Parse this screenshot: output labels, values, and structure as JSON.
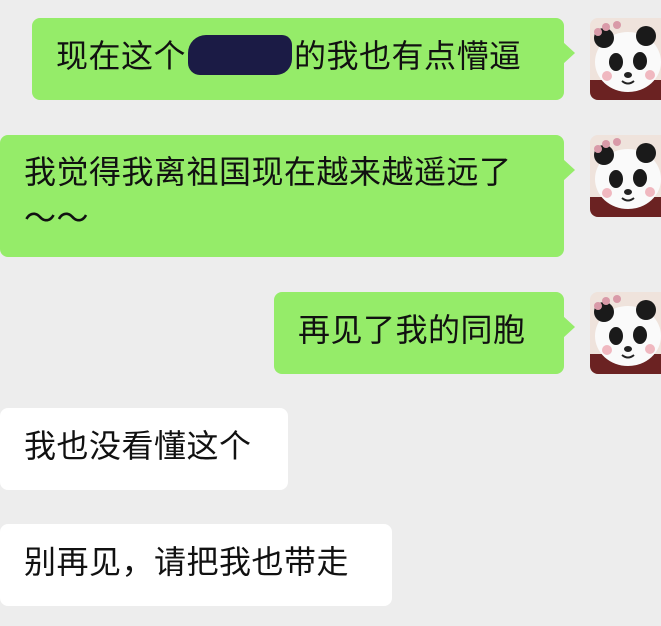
{
  "messages": [
    {
      "direction": "outgoing",
      "text_before": "现在这个",
      "redacted": true,
      "text_after": "的我也有点懵逼"
    },
    {
      "direction": "outgoing",
      "text": "我觉得我离祖国现在越来越遥远了～～"
    },
    {
      "direction": "outgoing",
      "text": "再见了我的同胞"
    },
    {
      "direction": "incoming",
      "text": "我也没看懂这个"
    },
    {
      "direction": "incoming",
      "text": "别再见，请把我也带走"
    }
  ],
  "avatar": {
    "icon": "panda-avatar-icon"
  },
  "colors": {
    "background": "#ededed",
    "outgoing_bubble": "#95ec69",
    "incoming_bubble": "#ffffff"
  }
}
